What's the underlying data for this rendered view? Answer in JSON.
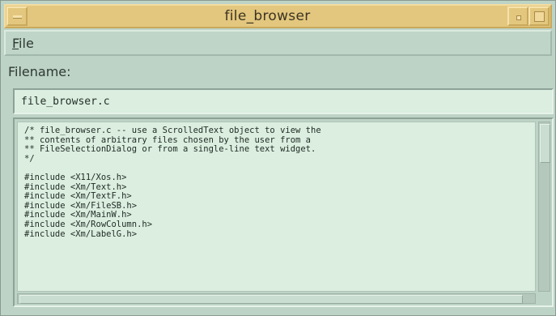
{
  "window": {
    "title": "file_browser"
  },
  "menubar": {
    "file_mnemonic": "F",
    "file_rest": "ile"
  },
  "form": {
    "filename_label": "Filename:",
    "filename_value": "file_browser.c"
  },
  "content": {
    "text": "/* file_browser.c -- use a ScrolledText object to view the\n** contents of arbitrary files chosen by the user from a\n** FileSelectionDialog or from a single-line text widget.\n*/\n\n#include <X11/Xos.h>\n#include <Xm/Text.h>\n#include <Xm/TextF.h>\n#include <Xm/FileSB.h>\n#include <Xm/MainW.h>\n#include <Xm/RowColumn.h>\n#include <Xm/LabelG.h>"
  },
  "icons": {
    "window_menu": "window-menu-icon",
    "minimize": "minimize-icon",
    "maximize": "maximize-icon"
  },
  "colors": {
    "titlebar": "#e3c77e",
    "background": "#bdd3c6",
    "text_bg": "#dbeee0"
  }
}
